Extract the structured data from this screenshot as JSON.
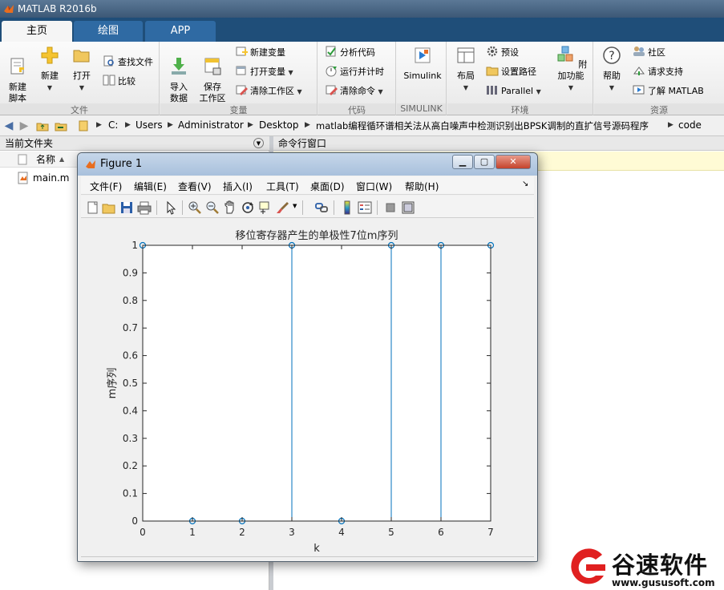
{
  "app": {
    "title": "MATLAB R2016b"
  },
  "tabs": [
    {
      "label": "主页",
      "active": true
    },
    {
      "label": "绘图",
      "active": false
    },
    {
      "label": "APP",
      "active": false
    }
  ],
  "ribbon": {
    "file_group": {
      "label": "文件",
      "new_script": "新建\n脚本",
      "new": "新建",
      "open": "打开",
      "find_files": "查找文件",
      "compare": "比较"
    },
    "variable_group": {
      "label": "变量",
      "import": "导入\n数据",
      "save_workspace": "保存\n工作区",
      "new_variable": "新建变量",
      "open_variable": "打开变量",
      "clear_workspace": "清除工作区"
    },
    "code_group": {
      "label": "代码",
      "analyze": "分析代码",
      "run_time": "运行并计时",
      "clear_commands": "清除命令"
    },
    "simulink_group": {
      "label": "SIMULINK",
      "simulink": "Simulink"
    },
    "env_group": {
      "label": "环境",
      "layout": "布局",
      "preferences": "预设",
      "set_path": "设置路径",
      "parallel": "Parallel",
      "addons": "附加功能"
    },
    "resources_group": {
      "label": "资源",
      "help": "帮助",
      "community": "社区",
      "support": "请求支持",
      "learn": "了解 MATLAB"
    }
  },
  "address": {
    "crumbs": [
      "C:",
      "Users",
      "Administrator",
      "Desktop",
      "matlab编程循环谱相关法从高白噪声中检测识别出BPSK调制的直扩信号源码程序",
      "code"
    ]
  },
  "left_panel": {
    "title": "当前文件夹",
    "column": "名称",
    "files": [
      {
        "name": "main.m"
      }
    ]
  },
  "command_window": {
    "title": "命令行窗口"
  },
  "figure": {
    "title": "Figure 1",
    "menu": [
      "文件(F)",
      "编辑(E)",
      "查看(V)",
      "插入(I)",
      "工具(T)",
      "桌面(D)",
      "窗口(W)",
      "帮助(H)"
    ],
    "toolbar_icons": [
      "new-figure-icon",
      "open-file-icon",
      "save-icon",
      "print-icon",
      "pointer-icon",
      "zoom-in-icon",
      "zoom-out-icon",
      "pan-hand-icon",
      "rotate-icon",
      "data-cursor-icon",
      "brush-icon",
      "link-icon",
      "colorbar-icon",
      "legend-icon",
      "hide-tools-icon",
      "show-tools-icon"
    ]
  },
  "chart_data": {
    "type": "stem",
    "title": "移位寄存器产生的单极性7位m序列",
    "xlabel": "k",
    "ylabel": "m序列",
    "x": [
      0,
      1,
      2,
      3,
      4,
      5,
      6,
      7
    ],
    "y": [
      1,
      0,
      0,
      1,
      0,
      1,
      1,
      1
    ],
    "xlim": [
      0,
      7
    ],
    "ylim": [
      0,
      1
    ],
    "xticks": [
      "0",
      "1",
      "2",
      "3",
      "4",
      "5",
      "6",
      "7"
    ],
    "yticks": [
      "0",
      "0.1",
      "0.2",
      "0.3",
      "0.4",
      "0.5",
      "0.6",
      "0.7",
      "0.8",
      "0.9",
      "1"
    ],
    "color": "#0072bd",
    "grid": false
  },
  "watermark": {
    "brand": "谷速软件",
    "url": "www.gususoft.com",
    "color": "#e02020"
  }
}
